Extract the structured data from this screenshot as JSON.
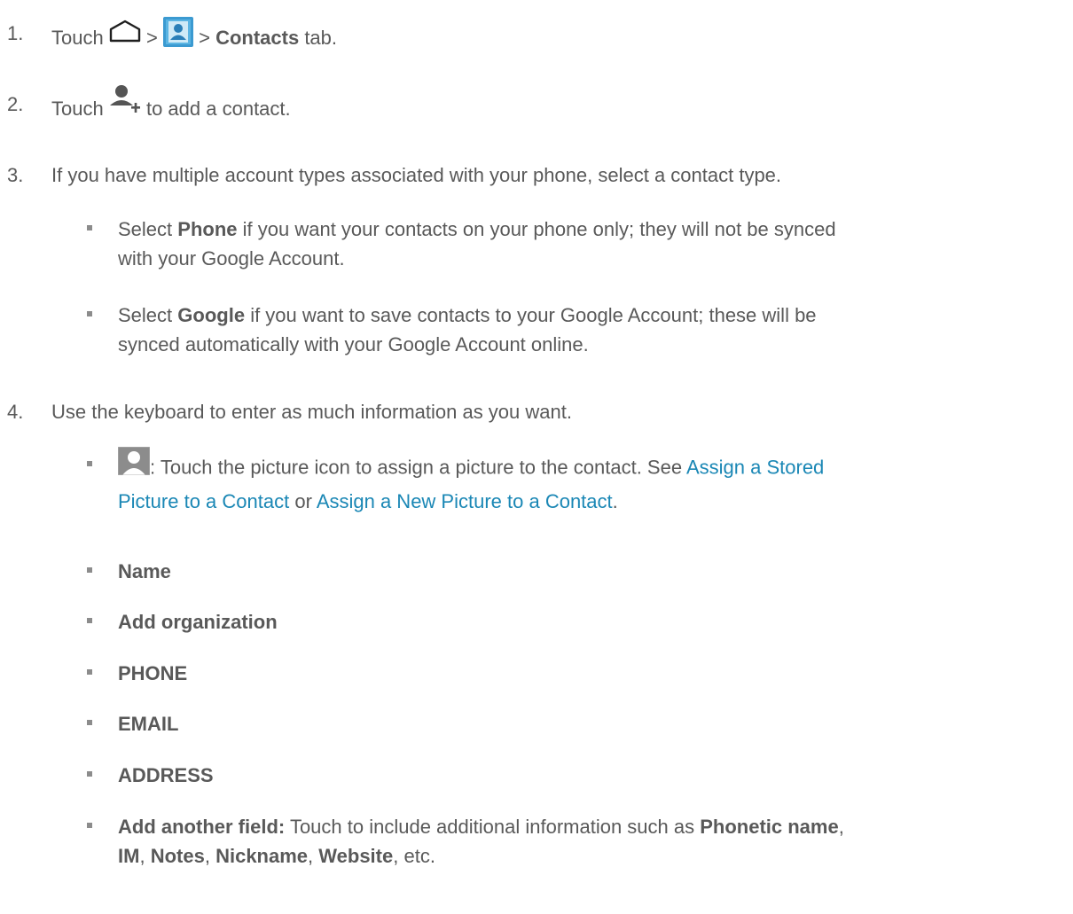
{
  "steps": [
    {
      "num": "1.",
      "touch": "Touch",
      "sep1": ">",
      "sep2": ">",
      "bold": "Contacts",
      "rest": "tab.",
      "icons": [
        "home-icon",
        "contacts-app-icon"
      ]
    },
    {
      "num": "2.",
      "touch": "Touch",
      "rest": "to add a contact.",
      "icons": [
        "add-contact-icon"
      ]
    },
    {
      "num": "3.",
      "text": "If you have multiple account types associated with your phone, select a contact type."
    },
    {
      "num": "4.",
      "text": "Use the keyboard to enter as much information as you want."
    }
  ],
  "account_bullets": [
    {
      "pre": "Select",
      "bold": "Phone",
      "line1": "if you want your contacts on your phone only; they will not be synced",
      "line2": "with your Google Account."
    },
    {
      "pre": "Select",
      "bold": "Google",
      "line1": "if you want to save contacts to your Google Account; these will be",
      "line2": "synced automatically with your Google Account online."
    }
  ],
  "picture_bullet": {
    "icon": "contact-picture-icon",
    "line1": ": Touch the picture icon to assign a picture to the contact. See",
    "link1a": "Assign a Stored",
    "link1b": "Picture to a Contact",
    "or": "or",
    "link2": "Assign a New Picture to a Contact",
    "end": "."
  },
  "field_bullets": [
    "Name",
    "Add organization",
    "PHONE",
    "EMAIL",
    "ADDRESS"
  ],
  "another_field": {
    "bold": "Add another field:",
    "line1": "Touch to include additional information such as",
    "phonetic": "Phonetic name",
    "im": "IM",
    "notes": "Notes",
    "nickname": "Nickname",
    "website": "Website",
    "etc": "etc.",
    "comma": ","
  },
  "colors": {
    "text": "#595959",
    "link": "#1a87b5",
    "bullet": "#8c8c8c"
  }
}
